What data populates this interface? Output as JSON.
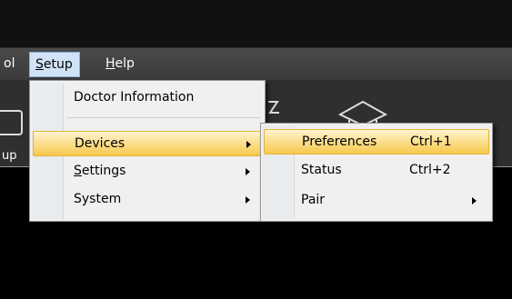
{
  "menubar": {
    "partial_left": "ol",
    "setup_label": "Setup",
    "help_label": "Help"
  },
  "toolbar": {
    "partial_label": "up"
  },
  "setup_menu": {
    "doctor_information": "Doctor Information",
    "devices": "Devices",
    "settings": "Settings",
    "system": "System"
  },
  "devices_submenu": {
    "preferences": "Preferences",
    "preferences_shortcut": "Ctrl+1",
    "status": "Status",
    "status_shortcut": "Ctrl+2",
    "pair": "Pair"
  },
  "colors": {
    "highlight": "#f9d77a",
    "menubar_active": "#cfe2f6"
  },
  "icons": [
    "toolbar-partial-icon",
    "toolbar-arrow-icon",
    "graduation-cap-icon"
  ]
}
